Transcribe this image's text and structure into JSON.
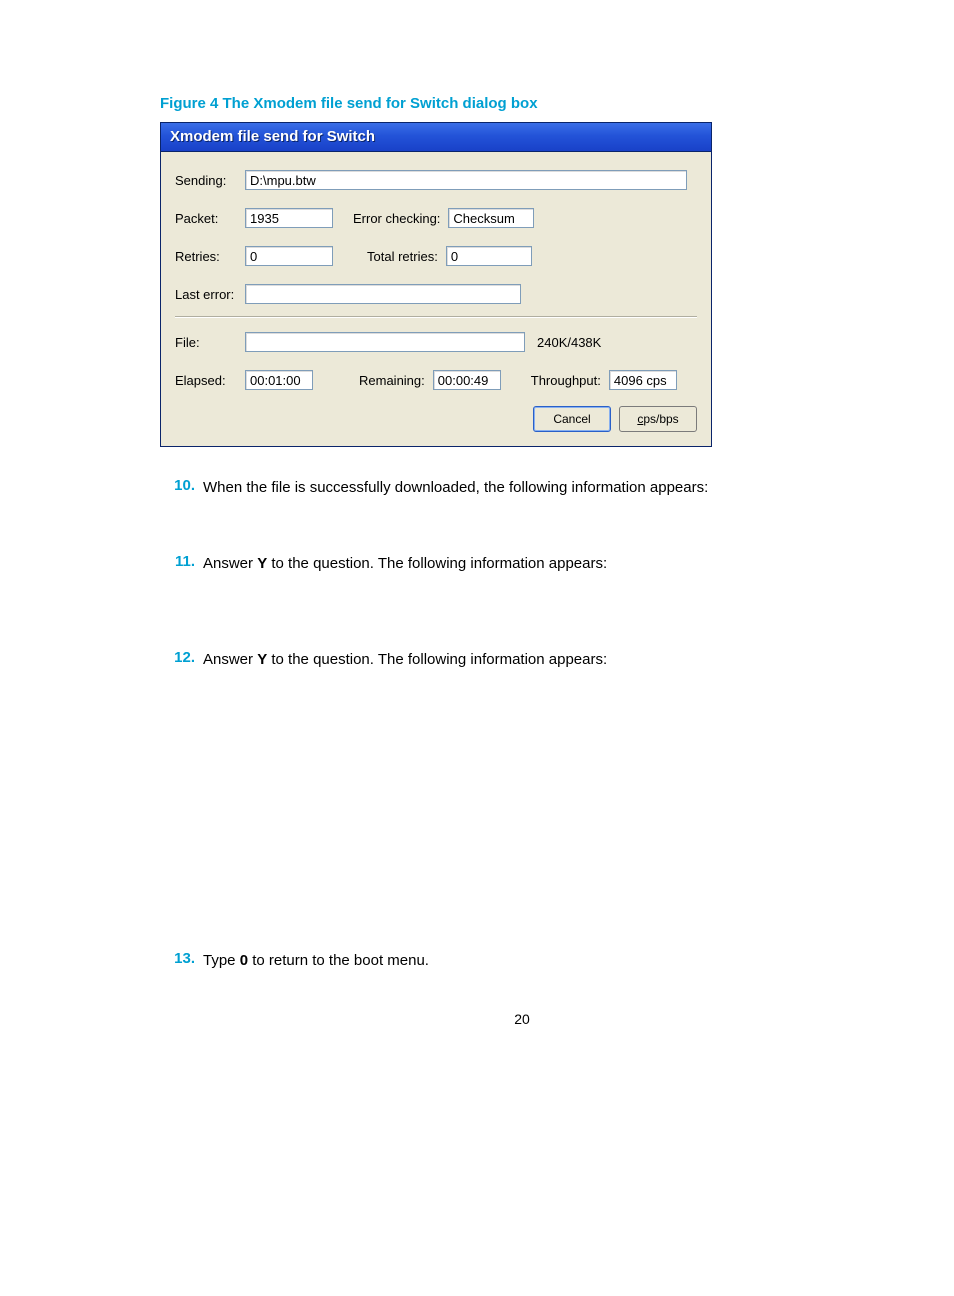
{
  "figure_caption": "Figure 4 The Xmodem file send for Switch dialog box",
  "dialog": {
    "title": "Xmodem file send for Switch",
    "labels": {
      "sending": "Sending:",
      "packet": "Packet:",
      "error_checking": "Error checking:",
      "retries": "Retries:",
      "total_retries": "Total retries:",
      "last_error": "Last error:",
      "file": "File:",
      "elapsed": "Elapsed:",
      "remaining": "Remaining:",
      "throughput": "Throughput:"
    },
    "values": {
      "sending": "D:\\mpu.btw",
      "packet": "1935",
      "error_checking": "Checksum",
      "retries": "0",
      "total_retries": "0",
      "last_error": "",
      "file_label": "240K/438K",
      "elapsed": "00:01:00",
      "remaining": "00:00:49",
      "throughput": "4096 cps"
    },
    "buttons": {
      "cancel": "Cancel",
      "cpsbps_prefix": "c",
      "cpsbps_rest": "ps/bps"
    }
  },
  "steps": [
    {
      "num": "10.",
      "text_before": "When the file is successfully downloaded, the following information appears:",
      "bold": "",
      "text_after": ""
    },
    {
      "num": "11.",
      "text_before": "Answer ",
      "bold": "Y",
      "text_after": " to the question. The following information appears:"
    },
    {
      "num": "12.",
      "text_before": "Answer ",
      "bold": "Y",
      "text_after": " to the question. The following information appears:"
    },
    {
      "num": "13.",
      "text_before": "Type ",
      "bold": "0",
      "text_after": " to return to the boot menu."
    }
  ],
  "page_number": "20"
}
